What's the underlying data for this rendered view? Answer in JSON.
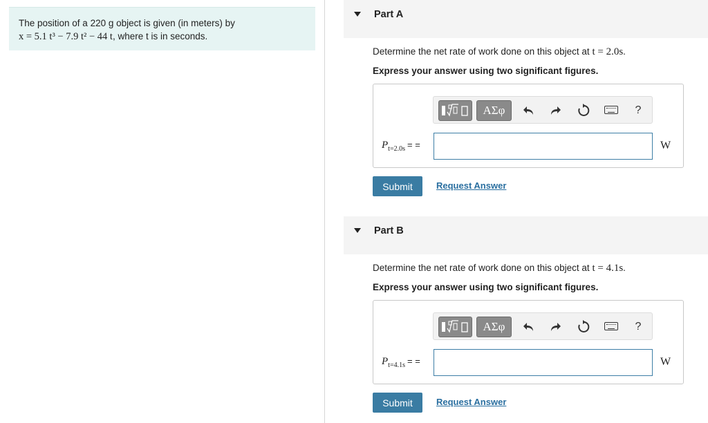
{
  "problem": {
    "line1": "The position of a 220 g object is given (in meters) by",
    "equation": "x = 5.1 t³ − 7.9 t² − 44 t",
    "line2_suffix": ", where t is in seconds."
  },
  "parts": [
    {
      "title": "Part A",
      "question_prefix": "Determine the net rate of work done on this object at ",
      "question_math": "t = 2.0s",
      "question_suffix": ".",
      "instruction": "Express your answer using two significant figures.",
      "var_symbol": "P",
      "var_subscript": "t=2.0s",
      "equals": "= =",
      "answer_value": "",
      "unit": "W",
      "submit_label": "Submit",
      "request_label": "Request Answer"
    },
    {
      "title": "Part B",
      "question_prefix": "Determine the net rate of work done on this object at ",
      "question_math": "t = 4.1s",
      "question_suffix": ".",
      "instruction": "Express your answer using two significant figures.",
      "var_symbol": "P",
      "var_subscript": "t=4.1s",
      "equals": "= =",
      "answer_value": "",
      "unit": "W",
      "submit_label": "Submit",
      "request_label": "Request Answer"
    }
  ],
  "toolbar": {
    "greek_label": "ΑΣφ",
    "help_label": "?"
  }
}
